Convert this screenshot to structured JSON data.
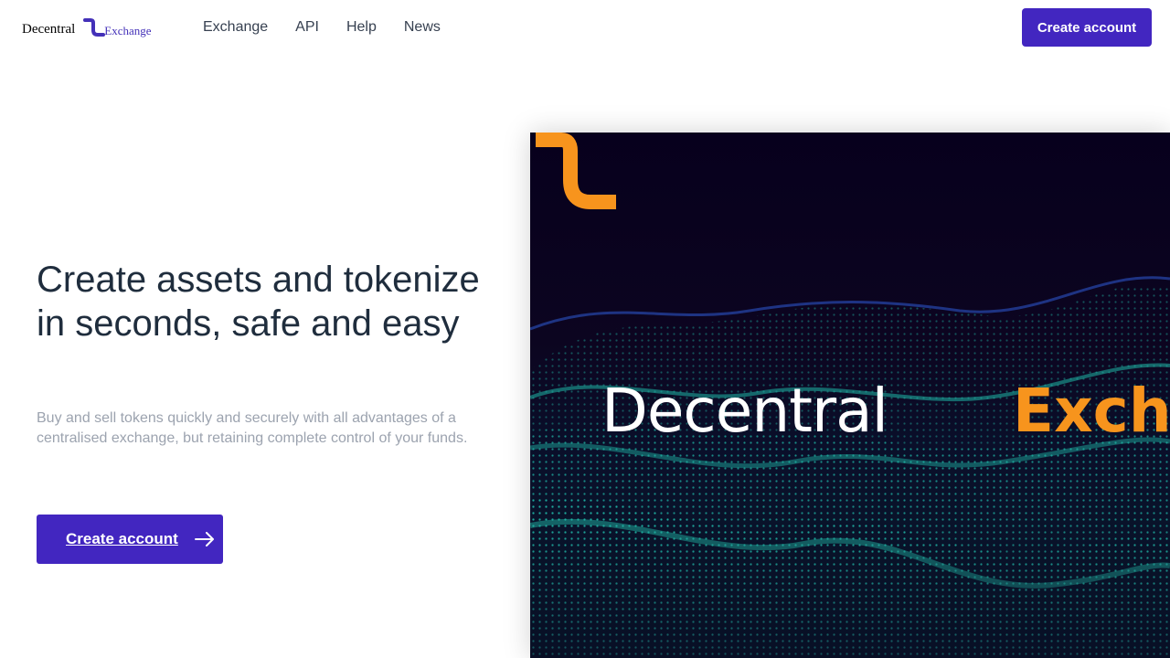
{
  "header": {
    "logo": {
      "word1": "Decentral",
      "word2": "Exchange"
    },
    "nav": [
      {
        "label": "Exchange"
      },
      {
        "label": "API"
      },
      {
        "label": "Help"
      },
      {
        "label": "News"
      }
    ],
    "cta_label": "Create account"
  },
  "hero": {
    "title": "Create assets and tokenize in seconds, safe and easy",
    "subtitle": "Buy and sell tokens quickly and securely with all advantages of a centralised exchange, but retaining complete control of your funds.",
    "cta_label": "Create account",
    "cta_icon": "arrow-right-icon",
    "image": {
      "brand_word1": "Decentral",
      "brand_word2": "Excha"
    }
  },
  "colors": {
    "primary": "#4226c0",
    "brand_orange": "#f7941d",
    "title": "#1f2d3d",
    "muted": "#9ca3af",
    "wave_teal": "#1fb7a6",
    "wave_blue": "#2f5bd6"
  }
}
